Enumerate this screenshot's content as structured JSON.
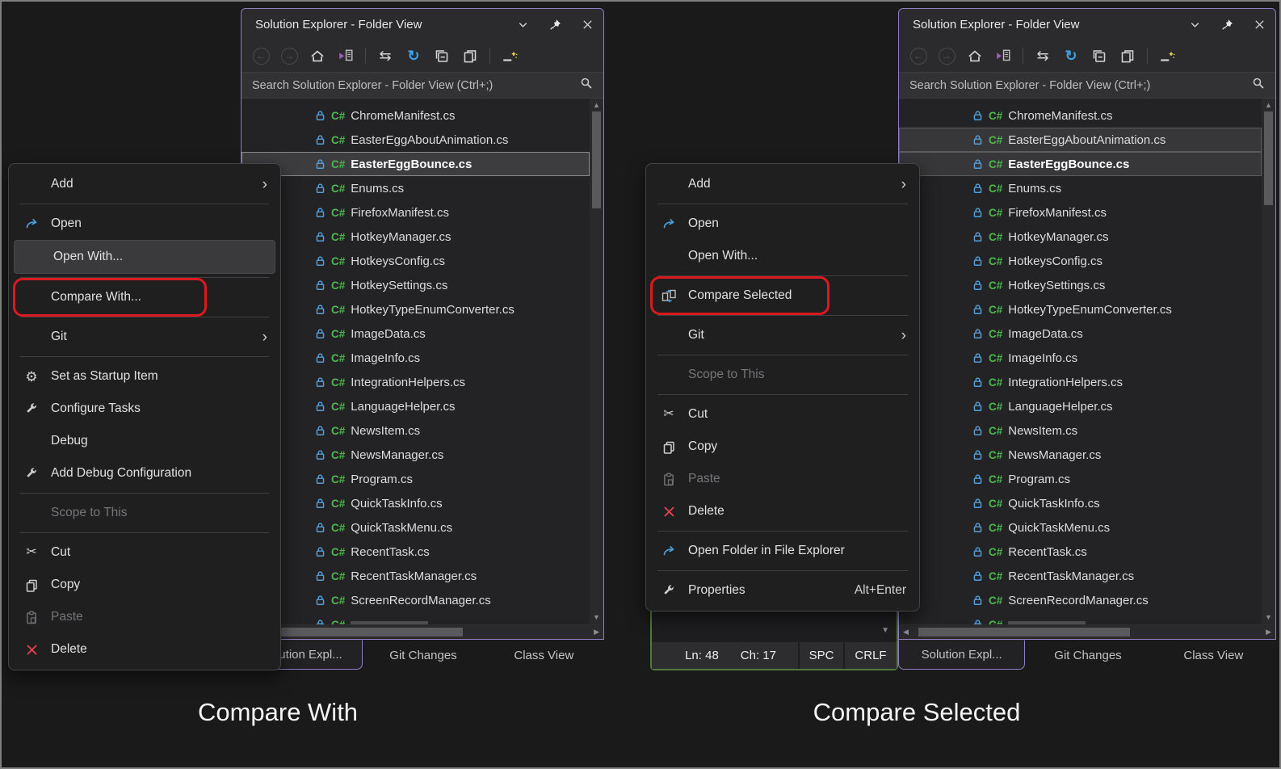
{
  "window": {
    "title": "Solution Explorer - Folder View",
    "search_placeholder": "Search Solution Explorer - Folder View (Ctrl+;)",
    "controls": [
      "chevron-down",
      "pin",
      "close"
    ],
    "toolbar": [
      "back",
      "forward",
      "home",
      "sync-active-document",
      "sep",
      "switch-views",
      "refresh",
      "collapse-all",
      "show-all-files",
      "sep",
      "new-item"
    ]
  },
  "files": [
    "ChromeManifest.cs",
    "EasterEggAboutAnimation.cs",
    "EasterEggBounce.cs",
    "Enums.cs",
    "FirefoxManifest.cs",
    "HotkeyManager.cs",
    "HotkeysConfig.cs",
    "HotkeySettings.cs",
    "HotkeyTypeEnumConverter.cs",
    "ImageData.cs",
    "ImageInfo.cs",
    "IntegrationHelpers.cs",
    "LanguageHelper.cs",
    "NewsItem.cs",
    "NewsManager.cs",
    "Program.cs",
    "QuickTaskInfo.cs",
    "QuickTaskMenu.cs",
    "RecentTask.cs",
    "RecentTaskManager.cs",
    "ScreenRecordManager.cs"
  ],
  "selection": {
    "left": {
      "selected": [
        2
      ],
      "strong": [
        2
      ],
      "bold": [
        2
      ]
    },
    "right": {
      "selected": [
        1,
        2
      ],
      "strong": [],
      "bold": [
        2
      ]
    }
  },
  "left_menu": [
    {
      "label": "Add",
      "submenu": true
    },
    {
      "sep": true
    },
    {
      "label": "Open",
      "icon": "open-arrow"
    },
    {
      "label": "Open With...",
      "highlighted": true
    },
    {
      "sep": true
    },
    {
      "label": "Compare With...",
      "annotated": true
    },
    {
      "sep": true
    },
    {
      "label": "Git",
      "submenu": true
    },
    {
      "sep": true
    },
    {
      "label": "Set as Startup Item",
      "icon": "gear"
    },
    {
      "label": "Configure Tasks",
      "icon": "wrench"
    },
    {
      "label": "Debug"
    },
    {
      "label": "Add Debug Configuration",
      "icon": "wrench"
    },
    {
      "sep": true
    },
    {
      "label": "Scope to This",
      "disabled": true
    },
    {
      "sep": true
    },
    {
      "label": "Cut",
      "icon": "scissors"
    },
    {
      "label": "Copy",
      "icon": "copy"
    },
    {
      "label": "Paste",
      "icon": "paste",
      "disabled": true
    },
    {
      "label": "Delete",
      "icon": "delete"
    }
  ],
  "right_menu": [
    {
      "label": "Add",
      "submenu": true
    },
    {
      "sep": true
    },
    {
      "label": "Open",
      "icon": "open-arrow"
    },
    {
      "label": "Open With..."
    },
    {
      "sep": true
    },
    {
      "label": "Compare Selected",
      "icon": "compare",
      "annotated": true
    },
    {
      "sep": true
    },
    {
      "label": "Git",
      "submenu": true
    },
    {
      "sep": true
    },
    {
      "label": "Scope to This",
      "disabled": true
    },
    {
      "sep": true
    },
    {
      "label": "Cut",
      "icon": "scissors"
    },
    {
      "label": "Copy",
      "icon": "copy"
    },
    {
      "label": "Paste",
      "icon": "paste",
      "disabled": true
    },
    {
      "label": "Delete",
      "icon": "delete"
    },
    {
      "sep": true
    },
    {
      "label": "Open Folder in File Explorer",
      "icon": "open-arrow"
    },
    {
      "sep": true
    },
    {
      "label": "Properties",
      "icon": "wrench",
      "shortcut": "Alt+Enter"
    }
  ],
  "tabs": [
    "Solution Expl...",
    "Git Changes",
    "Class View"
  ],
  "status": {
    "ln": "Ln: 48",
    "ch": "Ch: 17",
    "spc": "SPC",
    "crlf": "CRLF"
  },
  "captions": {
    "left": "Compare With",
    "right": "Compare Selected"
  },
  "colors": {
    "accent_purple": "#8f7fc2",
    "focus_green": "#517b34",
    "annotation_red": "#db1a20",
    "csharp_green": "#4db84d",
    "lock_blue": "#569cd6",
    "refresh_blue": "#3ca1e6"
  }
}
